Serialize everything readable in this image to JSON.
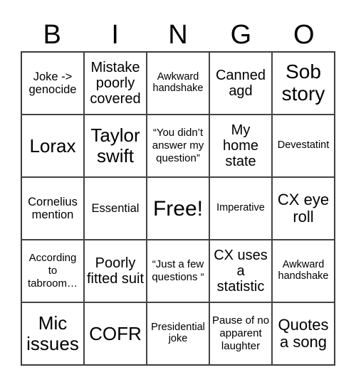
{
  "header": {
    "letters": [
      "B",
      "I",
      "N",
      "G",
      "O"
    ]
  },
  "card": {
    "rows": [
      [
        "Joke -> genocide",
        "Mistake poorly covered",
        "Awkward handshake",
        "Canned agd",
        "Sob story"
      ],
      [
        "Lorax",
        "Taylor swift",
        "“You didn’t answer my question”",
        "My home state",
        "Devestatint"
      ],
      [
        "Cornelius mention",
        "Essential",
        "Free!",
        "Imperative",
        "CX eye roll"
      ],
      [
        "According to tabroom…",
        "Poorly fitted suit",
        "“Just a few questions “",
        "CX uses a statistic",
        "Awkward handshake"
      ],
      [
        "Mic issues",
        "COFR",
        "Presidential joke",
        "Pause of no apparent laughter",
        "Quotes a song"
      ]
    ],
    "free_space": "Free!"
  }
}
